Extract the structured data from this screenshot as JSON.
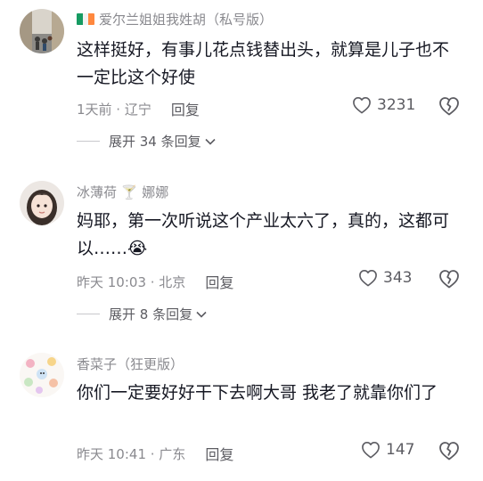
{
  "comments": [
    {
      "username": "爱尔兰姐姐我姓胡（私号版）",
      "text": "这样挺好，有事儿花点钱替出头，就算是儿子也不一定比这个好使",
      "time_location": "1天前 · 辽宁",
      "reply_label": "回复",
      "likes": "3231",
      "expand_label": "展开 34 条回复"
    },
    {
      "username": "冰薄荷 🍸 娜娜",
      "text": "妈耶，第一次听说这个产业太六了，真的，这都可以……😭",
      "time_location": "昨天 10:03 · 北京",
      "reply_label": "回复",
      "likes": "343",
      "expand_label": "展开 8 条回复"
    },
    {
      "username": "香菜子（狂更版）",
      "text": "你们一定要好好干下去啊大哥 我老了就靠你们了",
      "time_location": "昨天 10:41 · 广东",
      "reply_label": "回复",
      "likes": "147"
    }
  ],
  "colors": {
    "secondary_text": "#8a8a8f",
    "primary_text": "#161823",
    "flag_green": "#169b62",
    "flag_white": "#ffffff",
    "flag_orange": "#ff883e"
  },
  "icons": {
    "like": "heart-outline-icon",
    "dislike": "broken-heart-icon",
    "expand": "chevron-down-icon"
  }
}
